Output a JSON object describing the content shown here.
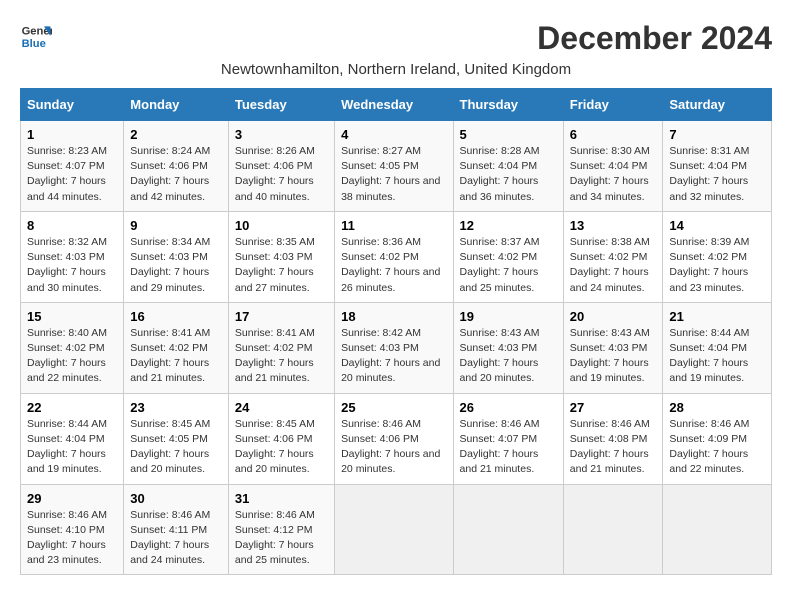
{
  "logo": {
    "line1": "General",
    "line2": "Blue"
  },
  "title": "December 2024",
  "subtitle": "Newtownhamilton, Northern Ireland, United Kingdom",
  "days_of_week": [
    "Sunday",
    "Monday",
    "Tuesday",
    "Wednesday",
    "Thursday",
    "Friday",
    "Saturday"
  ],
  "weeks": [
    [
      {
        "day": "1",
        "sunrise": "Sunrise: 8:23 AM",
        "sunset": "Sunset: 4:07 PM",
        "daylight": "Daylight: 7 hours and 44 minutes."
      },
      {
        "day": "2",
        "sunrise": "Sunrise: 8:24 AM",
        "sunset": "Sunset: 4:06 PM",
        "daylight": "Daylight: 7 hours and 42 minutes."
      },
      {
        "day": "3",
        "sunrise": "Sunrise: 8:26 AM",
        "sunset": "Sunset: 4:06 PM",
        "daylight": "Daylight: 7 hours and 40 minutes."
      },
      {
        "day": "4",
        "sunrise": "Sunrise: 8:27 AM",
        "sunset": "Sunset: 4:05 PM",
        "daylight": "Daylight: 7 hours and 38 minutes."
      },
      {
        "day": "5",
        "sunrise": "Sunrise: 8:28 AM",
        "sunset": "Sunset: 4:04 PM",
        "daylight": "Daylight: 7 hours and 36 minutes."
      },
      {
        "day": "6",
        "sunrise": "Sunrise: 8:30 AM",
        "sunset": "Sunset: 4:04 PM",
        "daylight": "Daylight: 7 hours and 34 minutes."
      },
      {
        "day": "7",
        "sunrise": "Sunrise: 8:31 AM",
        "sunset": "Sunset: 4:04 PM",
        "daylight": "Daylight: 7 hours and 32 minutes."
      }
    ],
    [
      {
        "day": "8",
        "sunrise": "Sunrise: 8:32 AM",
        "sunset": "Sunset: 4:03 PM",
        "daylight": "Daylight: 7 hours and 30 minutes."
      },
      {
        "day": "9",
        "sunrise": "Sunrise: 8:34 AM",
        "sunset": "Sunset: 4:03 PM",
        "daylight": "Daylight: 7 hours and 29 minutes."
      },
      {
        "day": "10",
        "sunrise": "Sunrise: 8:35 AM",
        "sunset": "Sunset: 4:03 PM",
        "daylight": "Daylight: 7 hours and 27 minutes."
      },
      {
        "day": "11",
        "sunrise": "Sunrise: 8:36 AM",
        "sunset": "Sunset: 4:02 PM",
        "daylight": "Daylight: 7 hours and 26 minutes."
      },
      {
        "day": "12",
        "sunrise": "Sunrise: 8:37 AM",
        "sunset": "Sunset: 4:02 PM",
        "daylight": "Daylight: 7 hours and 25 minutes."
      },
      {
        "day": "13",
        "sunrise": "Sunrise: 8:38 AM",
        "sunset": "Sunset: 4:02 PM",
        "daylight": "Daylight: 7 hours and 24 minutes."
      },
      {
        "day": "14",
        "sunrise": "Sunrise: 8:39 AM",
        "sunset": "Sunset: 4:02 PM",
        "daylight": "Daylight: 7 hours and 23 minutes."
      }
    ],
    [
      {
        "day": "15",
        "sunrise": "Sunrise: 8:40 AM",
        "sunset": "Sunset: 4:02 PM",
        "daylight": "Daylight: 7 hours and 22 minutes."
      },
      {
        "day": "16",
        "sunrise": "Sunrise: 8:41 AM",
        "sunset": "Sunset: 4:02 PM",
        "daylight": "Daylight: 7 hours and 21 minutes."
      },
      {
        "day": "17",
        "sunrise": "Sunrise: 8:41 AM",
        "sunset": "Sunset: 4:02 PM",
        "daylight": "Daylight: 7 hours and 21 minutes."
      },
      {
        "day": "18",
        "sunrise": "Sunrise: 8:42 AM",
        "sunset": "Sunset: 4:03 PM",
        "daylight": "Daylight: 7 hours and 20 minutes."
      },
      {
        "day": "19",
        "sunrise": "Sunrise: 8:43 AM",
        "sunset": "Sunset: 4:03 PM",
        "daylight": "Daylight: 7 hours and 20 minutes."
      },
      {
        "day": "20",
        "sunrise": "Sunrise: 8:43 AM",
        "sunset": "Sunset: 4:03 PM",
        "daylight": "Daylight: 7 hours and 19 minutes."
      },
      {
        "day": "21",
        "sunrise": "Sunrise: 8:44 AM",
        "sunset": "Sunset: 4:04 PM",
        "daylight": "Daylight: 7 hours and 19 minutes."
      }
    ],
    [
      {
        "day": "22",
        "sunrise": "Sunrise: 8:44 AM",
        "sunset": "Sunset: 4:04 PM",
        "daylight": "Daylight: 7 hours and 19 minutes."
      },
      {
        "day": "23",
        "sunrise": "Sunrise: 8:45 AM",
        "sunset": "Sunset: 4:05 PM",
        "daylight": "Daylight: 7 hours and 20 minutes."
      },
      {
        "day": "24",
        "sunrise": "Sunrise: 8:45 AM",
        "sunset": "Sunset: 4:06 PM",
        "daylight": "Daylight: 7 hours and 20 minutes."
      },
      {
        "day": "25",
        "sunrise": "Sunrise: 8:46 AM",
        "sunset": "Sunset: 4:06 PM",
        "daylight": "Daylight: 7 hours and 20 minutes."
      },
      {
        "day": "26",
        "sunrise": "Sunrise: 8:46 AM",
        "sunset": "Sunset: 4:07 PM",
        "daylight": "Daylight: 7 hours and 21 minutes."
      },
      {
        "day": "27",
        "sunrise": "Sunrise: 8:46 AM",
        "sunset": "Sunset: 4:08 PM",
        "daylight": "Daylight: 7 hours and 21 minutes."
      },
      {
        "day": "28",
        "sunrise": "Sunrise: 8:46 AM",
        "sunset": "Sunset: 4:09 PM",
        "daylight": "Daylight: 7 hours and 22 minutes."
      }
    ],
    [
      {
        "day": "29",
        "sunrise": "Sunrise: 8:46 AM",
        "sunset": "Sunset: 4:10 PM",
        "daylight": "Daylight: 7 hours and 23 minutes."
      },
      {
        "day": "30",
        "sunrise": "Sunrise: 8:46 AM",
        "sunset": "Sunset: 4:11 PM",
        "daylight": "Daylight: 7 hours and 24 minutes."
      },
      {
        "day": "31",
        "sunrise": "Sunrise: 8:46 AM",
        "sunset": "Sunset: 4:12 PM",
        "daylight": "Daylight: 7 hours and 25 minutes."
      },
      null,
      null,
      null,
      null
    ]
  ]
}
